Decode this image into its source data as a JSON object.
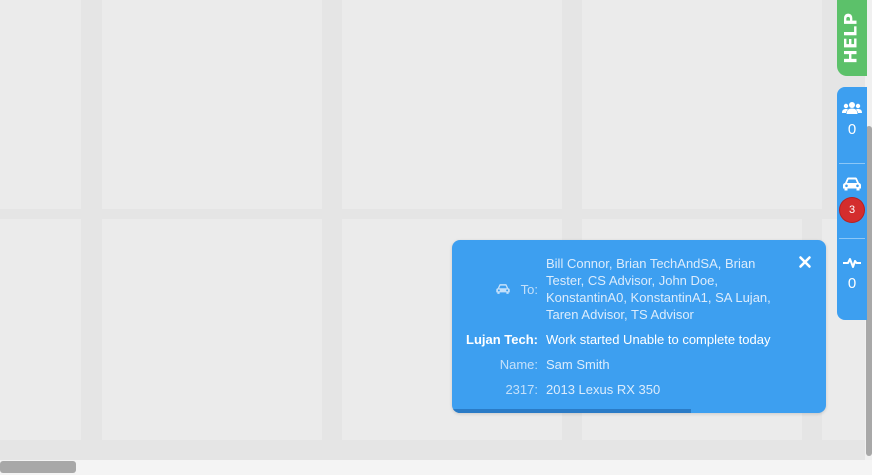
{
  "help_tab": {
    "label": "HELP"
  },
  "side_panel": {
    "users": {
      "icon": "users-icon",
      "count": "0"
    },
    "vehicles": {
      "icon": "car-icon",
      "badge": "3"
    },
    "activity": {
      "icon": "heartbeat-icon",
      "count": "0"
    }
  },
  "notification": {
    "to_label": "To:",
    "to_icon": "car-icon",
    "to_value": "Bill Connor, Brian TechAndSA, Brian Tester, CS Advisor, John Doe, KonstantinA0, KonstantinA1, SA Lujan, Taren Advisor, TS Advisor",
    "sender_label": "Lujan Tech:",
    "message": "Work started Unable to complete today",
    "name_label": "Name:",
    "name_value": "Sam Smith",
    "ro_label": "2317:",
    "vehicle": "2013 Lexus RX 350",
    "close_icon": "close-icon",
    "progress_fraction": 0.64
  },
  "colors": {
    "help_green": "#5cc16a",
    "panel_blue": "#3d9ff0",
    "badge_red": "#d42d2d",
    "background": "#e5e5e5"
  }
}
